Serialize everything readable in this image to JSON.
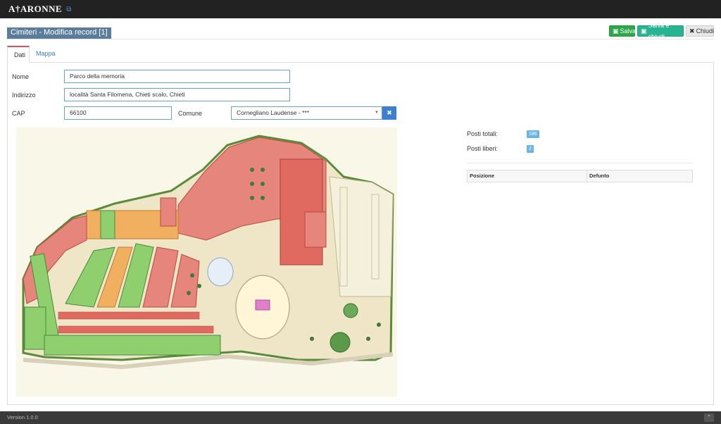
{
  "app": {
    "logo_text": "A†ARONNE",
    "external_icon": "external-link-icon"
  },
  "header": {
    "title": "Cimiteri - Modifica record [1]"
  },
  "toolbar": {
    "save_label": "Salva",
    "save_close_label": "Salva e chiudi",
    "close_label": "Chiudi",
    "save_icon": "floppy-icon",
    "close_icon": "x-icon"
  },
  "tabs": [
    {
      "label": "Dati"
    },
    {
      "label": "Mappa"
    }
  ],
  "form": {
    "nome_label": "Nome",
    "nome_value": "Parco della memoria",
    "indirizzo_label": "Indirizzo",
    "indirizzo_value": "località Santa Filomena, Chieti scalo, Chieti",
    "cap_label": "CAP",
    "cap_value": "66100",
    "comune_label": "Comune",
    "comune_value": "Cornegliano Laudense - ***"
  },
  "stats": {
    "posti_totali_label": "Posti totali:",
    "posti_totali_value": "186",
    "posti_liberi_label": "Posti liberi:",
    "posti_liberi_value": "2"
  },
  "table": {
    "columns": [
      "Posizione",
      "Defunto"
    ]
  },
  "footer": {
    "version": "Version 1.0.0"
  },
  "colors": {
    "topbar": "#222222",
    "accent_blue": "#3c7fd1",
    "save_green": "#2ca84a",
    "save_close_teal": "#27b591",
    "title_bg": "#5b7d9c",
    "occupied_red": "#e07870",
    "free_green": "#8fcf6e",
    "reserved_orange": "#f0b060"
  }
}
